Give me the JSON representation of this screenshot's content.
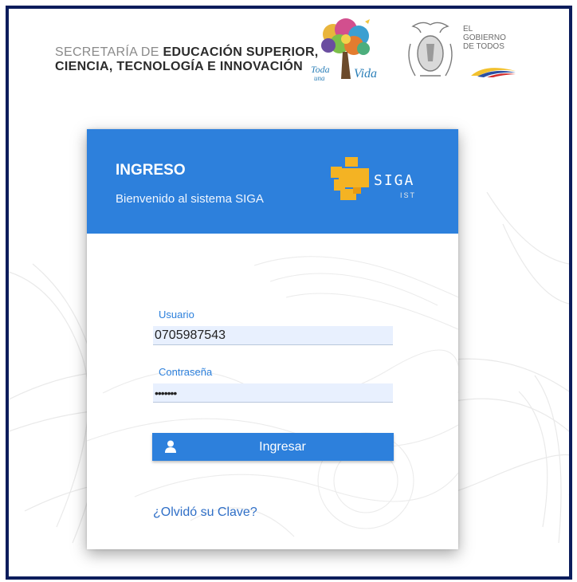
{
  "header": {
    "agency_line1_light": "SECRETARÍA DE ",
    "agency_line1_bold": "EDUCACIÓN SUPERIOR,",
    "agency_line2": "CIENCIA, TECNOLOGÍA E INNOVACIÓN",
    "toda_vida_text": "Toda una Vida",
    "gobierno_text": [
      "EL",
      "GOBIERNO",
      "DE TODOS"
    ]
  },
  "card": {
    "title": "INGRESO",
    "subtitle": "Bienvenido al sistema SIGA",
    "logo_text": "SIGA",
    "logo_subtext": "IST"
  },
  "form": {
    "username_label": "Usuario",
    "username_value": "0705987543",
    "password_label": "Contraseña",
    "password_value": "•••••••",
    "submit_label": "Ingresar",
    "forgot_label": "¿Olvidó su Clave?"
  },
  "colors": {
    "accent": "#2d80dc",
    "frame": "#0b1d5c",
    "field_bg": "#e8f0fe"
  }
}
